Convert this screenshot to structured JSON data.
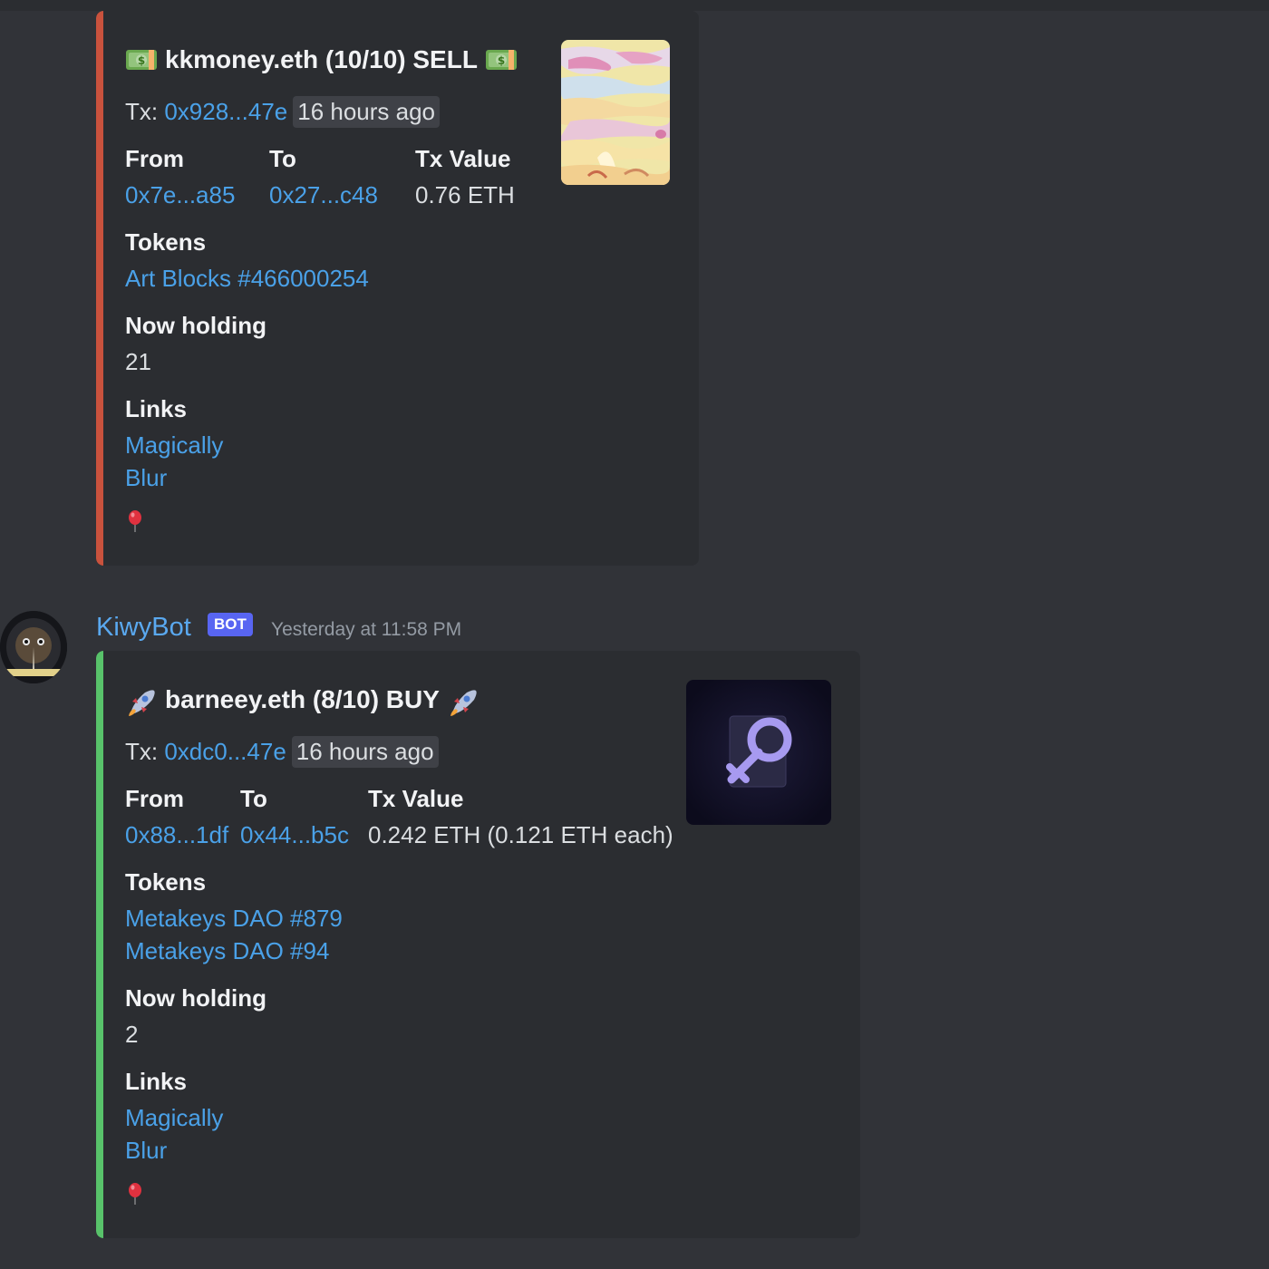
{
  "messages": [
    {
      "embed": {
        "title": "kkmoney.eth (10/10) SELL",
        "title_emoji": "money-bill-icon",
        "accent_color": "#c9523d",
        "tx_label": "Tx:",
        "tx_hash": "0x928...47e",
        "tx_time": "16 hours ago",
        "fields": {
          "from_label": "From",
          "from_value": "0x7e...a85",
          "to_label": "To",
          "to_value": "0x27...c48",
          "value_label": "Tx Value",
          "value_value": "0.76 ETH",
          "tokens_label": "Tokens",
          "tokens": [
            "Art Blocks #466000254"
          ],
          "holding_label": "Now holding",
          "holding_value": "21",
          "links_label": "Links",
          "links": [
            "Magically",
            "Blur"
          ]
        },
        "footer_icon": "balloon-icon"
      }
    },
    {
      "author": {
        "name": "KiwyBot",
        "badge": "BOT",
        "timestamp": "Yesterday at 11:58 PM"
      },
      "embed": {
        "title": "barneey.eth (8/10) BUY",
        "title_emoji": "rocket-icon",
        "accent_color": "#58c26a",
        "tx_label": "Tx:",
        "tx_hash": "0xdc0...47e",
        "tx_time": "16 hours ago",
        "fields": {
          "from_label": "From",
          "from_value": "0x88...1df",
          "to_label": "To",
          "to_value": "0x44...b5c",
          "value_label": "Tx Value",
          "value_value": "0.242 ETH (0.121 ETH each)",
          "tokens_label": "Tokens",
          "tokens": [
            "Metakeys DAO #879",
            "Metakeys DAO #94"
          ],
          "holding_label": "Now holding",
          "holding_value": "2",
          "links_label": "Links",
          "links": [
            "Magically",
            "Blur"
          ]
        },
        "footer_icon": "balloon-icon"
      }
    }
  ]
}
